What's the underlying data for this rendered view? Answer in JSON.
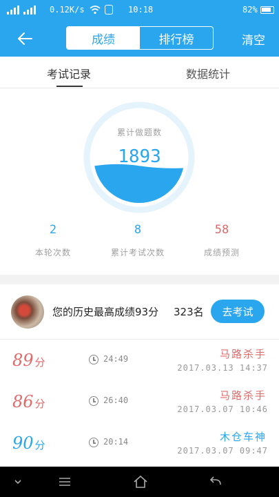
{
  "status_bar": {
    "speed": "0.12K/s",
    "time": "10:18",
    "battery": "82%"
  },
  "header": {
    "back_icon": "back-arrow-icon",
    "segments": [
      {
        "label": "成绩",
        "active": true
      },
      {
        "label": "排行榜",
        "active": false
      }
    ],
    "clear_label": "清空"
  },
  "tabs": [
    {
      "label": "考试记录",
      "active": true
    },
    {
      "label": "数据统计",
      "active": false
    }
  ],
  "gauge": {
    "label": "累计做题数",
    "value": "1893",
    "fill_fraction": 0.4
  },
  "stats": [
    {
      "value": "2",
      "label": "本轮次数",
      "color": "#2aa6ef"
    },
    {
      "value": "8",
      "label": "累计考试次数",
      "color": "#2aa6ef"
    },
    {
      "value": "58",
      "label": "成绩预测",
      "color": "#e06a6a"
    }
  ],
  "summary": {
    "text": "您的历史最高成绩93分",
    "rank": "323名",
    "button_label": "去考试"
  },
  "records": [
    {
      "score": "89",
      "unit": "分",
      "duration": "24:49",
      "title": "马路杀手",
      "date": "2017.03.13  14:37",
      "color": "#e06a6a"
    },
    {
      "score": "86",
      "unit": "分",
      "duration": "26:40",
      "title": "马路杀手",
      "date": "2017.03.07  10:46",
      "color": "#e06a6a"
    },
    {
      "score": "90",
      "unit": "分",
      "duration": "20:14",
      "title": "木仓车神",
      "date": "2017.03.07  09:47",
      "color": "#2aa6ef"
    }
  ],
  "colors": {
    "primary": "#2aa6ef",
    "danger": "#e06a6a"
  }
}
